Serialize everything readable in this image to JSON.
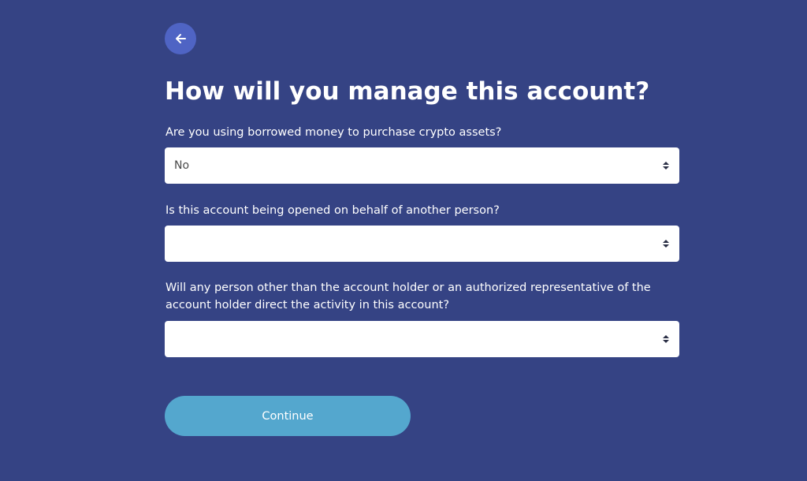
{
  "colors": {
    "background": "#354384",
    "back_button": "#4f64c4",
    "continue_button": "#54a7ce",
    "field_background": "#ffffff"
  },
  "nav": {
    "back_icon": "arrow-left-icon"
  },
  "title": "How will you manage this account?",
  "questions": [
    {
      "label": "Are you using borrowed money to purchase crypto assets?",
      "selected": "No"
    },
    {
      "label": "Is this account being opened on behalf of another person?",
      "selected": ""
    },
    {
      "label": "Will any person other than the account holder or an authorized representative of the account holder direct the activity in this account?",
      "selected": ""
    }
  ],
  "continue_label": "Continue"
}
